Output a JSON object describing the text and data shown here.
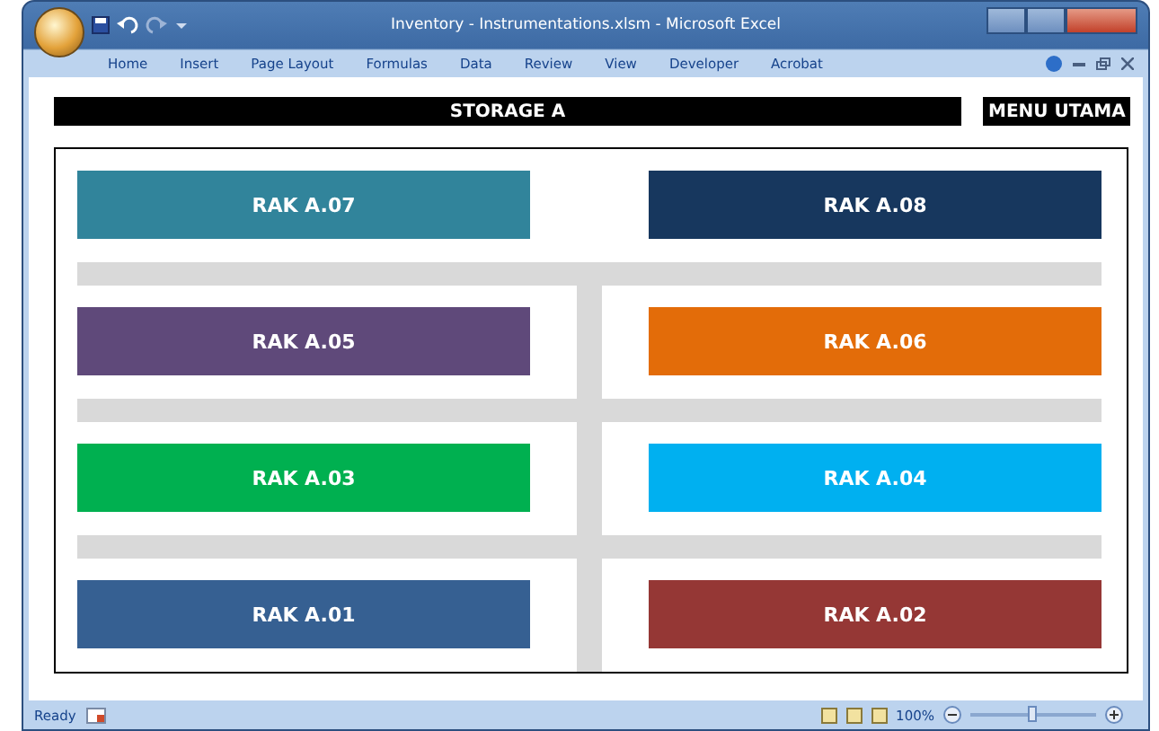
{
  "window": {
    "title": "Inventory - Instrumentations.xlsm - Microsoft Excel"
  },
  "ribbon_tabs": [
    "Home",
    "Insert",
    "Page Layout",
    "Formulas",
    "Data",
    "Review",
    "View",
    "Developer",
    "Acrobat"
  ],
  "sheet": {
    "header": "STORAGE A",
    "menu_button": "MENU UTAMA",
    "racks": [
      {
        "label": "RAK A.07",
        "color": "#31849b"
      },
      {
        "label": "RAK A.08",
        "color": "#17375e"
      },
      {
        "label": "RAK A.05",
        "color": "#5f497a"
      },
      {
        "label": "RAK A.06",
        "color": "#e36c09"
      },
      {
        "label": "RAK A.03",
        "color": "#00b050"
      },
      {
        "label": "RAK A.04",
        "color": "#00b0f0"
      },
      {
        "label": "RAK A.01",
        "color": "#366092"
      },
      {
        "label": "RAK A.02",
        "color": "#953735"
      }
    ]
  },
  "status_bar": {
    "status": "Ready",
    "zoom": {
      "reading": "100%",
      "level": 0.5
    }
  }
}
